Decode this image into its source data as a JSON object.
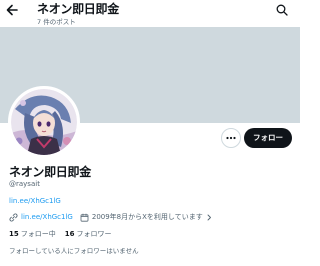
{
  "header": {
    "title": "ネオン即日即金",
    "post_count": "7 件のポスト"
  },
  "profile": {
    "display_name": "ネオン即日即金",
    "handle": "@raysait",
    "bio_link": "lin.ee/XhGc1lG",
    "meta": {
      "link": "lin.ee/XhGc1lG",
      "joined": "2009年8月からXを利用しています"
    },
    "following_count": "15",
    "following_label": "フォロー中",
    "followers_count": "16",
    "followers_label": "フォロワー",
    "mutual_note": "フォローしている人にフォロワーはいません"
  },
  "actions": {
    "follow_label": "フォロー"
  },
  "icons": {
    "back": "arrow-left-icon",
    "search": "search-icon",
    "more": "ellipsis-icon",
    "link": "link-icon",
    "calendar": "calendar-icon"
  },
  "colors": {
    "banner": "#cfd9de",
    "link": "#1d9bf0",
    "text": "#0f1419",
    "secondary": "#536471",
    "follow_button": "#0f1419"
  }
}
